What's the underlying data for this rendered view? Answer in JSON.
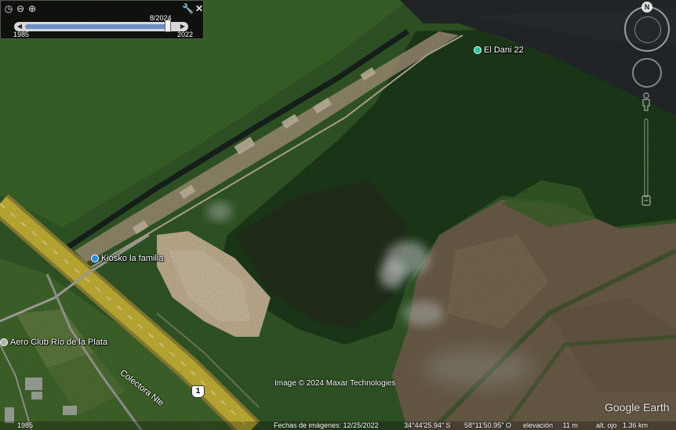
{
  "timebar": {
    "date_label": "8/2024",
    "start_year": "1985",
    "end_year": "2022",
    "position": 0.96
  },
  "places": {
    "kiosk": "Kiosko la familia",
    "el_dani": "El Dani 22",
    "aero_club": "Aero Club Río de la Plata",
    "road_name": "Colectora Nte",
    "route_shield": "1"
  },
  "imagery": {
    "copyright": "Image © 2024 Maxar Technologies",
    "logo": "Google Earth"
  },
  "statusbar": {
    "left_year": "1985",
    "imagery_date": "Fechas de imágenes: 12/25/2022",
    "lat": "34°44'25.94\" S",
    "lon": "58°11'50.95\" O",
    "elevation": "elevación     11 m",
    "eye_alt": "alt. ojo   1.36 km"
  },
  "nav": {
    "compass_north": "N"
  },
  "colors": {
    "water": "#262b2e",
    "marsh": "#7a6a52",
    "forest": "#20401c",
    "field": "#3d6b2a",
    "sand": "#d8c6a4",
    "road": "#d8c23c",
    "pin_blue": "#2b8ae6",
    "pin_teal": "#2fc4a0",
    "pin_grey": "#b0b0b0"
  }
}
